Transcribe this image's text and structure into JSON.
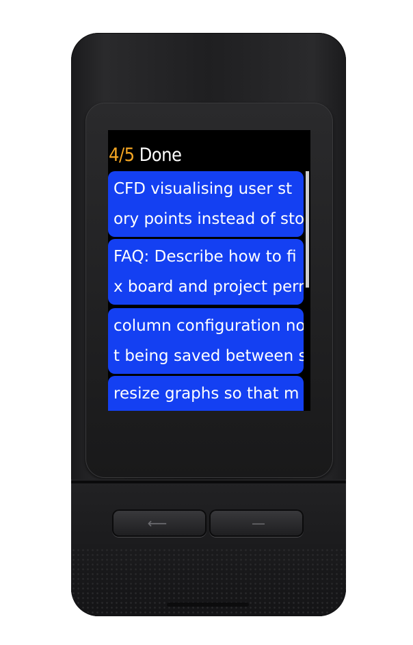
{
  "screen": {
    "header": {
      "count": "4/5",
      "title": "Done"
    },
    "cards": [
      {
        "line1": "CFD visualising user st",
        "line2": "ory points instead of sto"
      },
      {
        "line1": "FAQ: Describe how to fi",
        "line2": "x board and project perm"
      },
      {
        "line1": "column configuration no",
        "line2": "t being saved between se"
      },
      {
        "line1": "resize graphs so that m",
        "line2": ""
      }
    ]
  },
  "device": {
    "back_button_glyph": "⟵",
    "next_button_glyph": "—"
  },
  "colors": {
    "card": "#1440f2",
    "count": "#f5a623",
    "screen_bg": "#000000"
  }
}
